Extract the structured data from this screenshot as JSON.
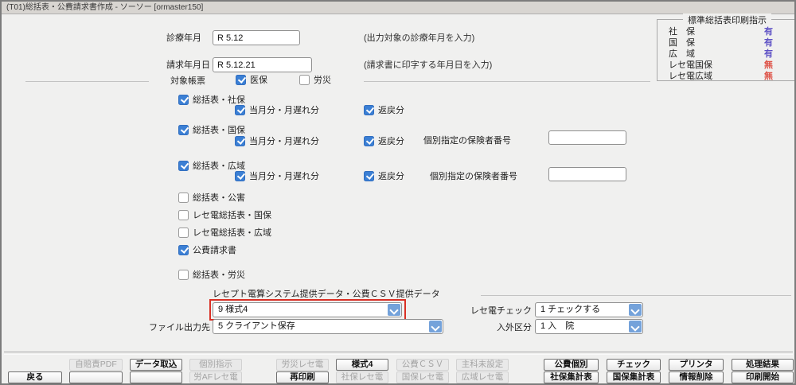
{
  "window_title": "(T01)総括表・公費請求書作成 - ソーソー [ormaster150]",
  "colors": {
    "accent_blue": "#3b7fd4",
    "combo_button_blue": "#74a2da",
    "highlight_red": "#d93025",
    "value_on_purple": "#5c4fc4",
    "value_off_red": "#de5348"
  },
  "print_panel": {
    "legend": "標準総括表印刷指示",
    "rows": [
      {
        "label": "社　保",
        "value": "有",
        "on": true
      },
      {
        "label": "国　保",
        "value": "有",
        "on": true
      },
      {
        "label": "広　域",
        "value": "有",
        "on": true
      },
      {
        "label": "レセ電国保",
        "value": "無",
        "on": false
      },
      {
        "label": "レセ電広域",
        "value": "無",
        "on": false
      }
    ]
  },
  "fields": {
    "shinryo_label": "診療年月",
    "shinryo_value": "R 5.12",
    "shinryo_hint": "(出力対象の診療年月を入力)",
    "seikyu_label": "請求年月日",
    "seikyu_value": "R 5.12.21",
    "seikyu_hint": "(請求書に印字する年月日を入力)",
    "taisho_label": "対象帳票"
  },
  "taisho_items": [
    {
      "label": "医保",
      "checked": true
    },
    {
      "label": "労災",
      "checked": false
    }
  ],
  "groups": [
    {
      "label": "総括表・社保",
      "checked": true,
      "c1": {
        "label": "当月分・月遅れ分",
        "checked": true
      },
      "c2": {
        "label": "返戻分",
        "checked": true
      }
    },
    {
      "label": "総括表・国保",
      "checked": true,
      "c1": {
        "label": "当月分・月遅れ分",
        "checked": true
      },
      "c2": {
        "label": "返戻分",
        "checked": true
      },
      "kobetsu_label": "個別指定の保険者番号",
      "kobetsu_value": ""
    },
    {
      "label": "総括表・広域",
      "checked": true,
      "c1": {
        "label": "当月分・月遅れ分",
        "checked": true
      },
      "c2": {
        "label": "返戻分",
        "checked": true
      },
      "kobetsu_label": "個別指定の保険者番号",
      "kobetsu_value": ""
    }
  ],
  "singles": [
    {
      "label": "総括表・公害",
      "checked": false
    },
    {
      "label": "レセ電総括表・国保",
      "checked": false
    },
    {
      "label": "レセ電総括表・広域",
      "checked": false
    },
    {
      "label": "公費請求書",
      "checked": true
    },
    {
      "label": "総括表・労災",
      "checked": false
    }
  ],
  "csv_section": {
    "title": "レセプト電算システム提供データ・公費ＣＳＶ提供データ",
    "format_value": "9 様式4",
    "file_label": "ファイル出力先",
    "file_value": "5 クライアント保存",
    "check_label": "レセ電チェック",
    "check_value": "1 チェックする",
    "nyugai_label": "入外区分",
    "nyugai_value": "1 入　院"
  },
  "buttons": {
    "row1": [
      {
        "label": "自賠責PDF",
        "enabled": false
      },
      {
        "label": "データ取込",
        "enabled": true
      },
      {
        "label": "個別指示",
        "enabled": false
      },
      {
        "label": "労災レセ電",
        "enabled": false
      },
      {
        "label": "様式4",
        "enabled": true
      },
      {
        "label": "公費ＣＳＶ",
        "enabled": false
      },
      {
        "label": "主科未設定",
        "enabled": false
      },
      {
        "label": "公費個別",
        "enabled": true
      },
      {
        "label": "チェック",
        "enabled": true
      },
      {
        "label": "プリンタ",
        "enabled": true
      },
      {
        "label": "処理結果",
        "enabled": true
      }
    ],
    "row2": [
      {
        "label": "戻る",
        "enabled": true
      },
      {
        "label": "",
        "enabled": true
      },
      {
        "label": "",
        "enabled": true
      },
      {
        "label": "労AFレセ電",
        "enabled": false
      },
      {
        "label": "再印刷",
        "enabled": true
      },
      {
        "label": "社保レセ電",
        "enabled": false
      },
      {
        "label": "国保レセ電",
        "enabled": false
      },
      {
        "label": "広域レセ電",
        "enabled": false
      },
      {
        "label": "社保集計表",
        "enabled": true
      },
      {
        "label": "国保集計表",
        "enabled": true
      },
      {
        "label": "情報削除",
        "enabled": true
      },
      {
        "label": "印刷開始",
        "enabled": true
      }
    ]
  }
}
